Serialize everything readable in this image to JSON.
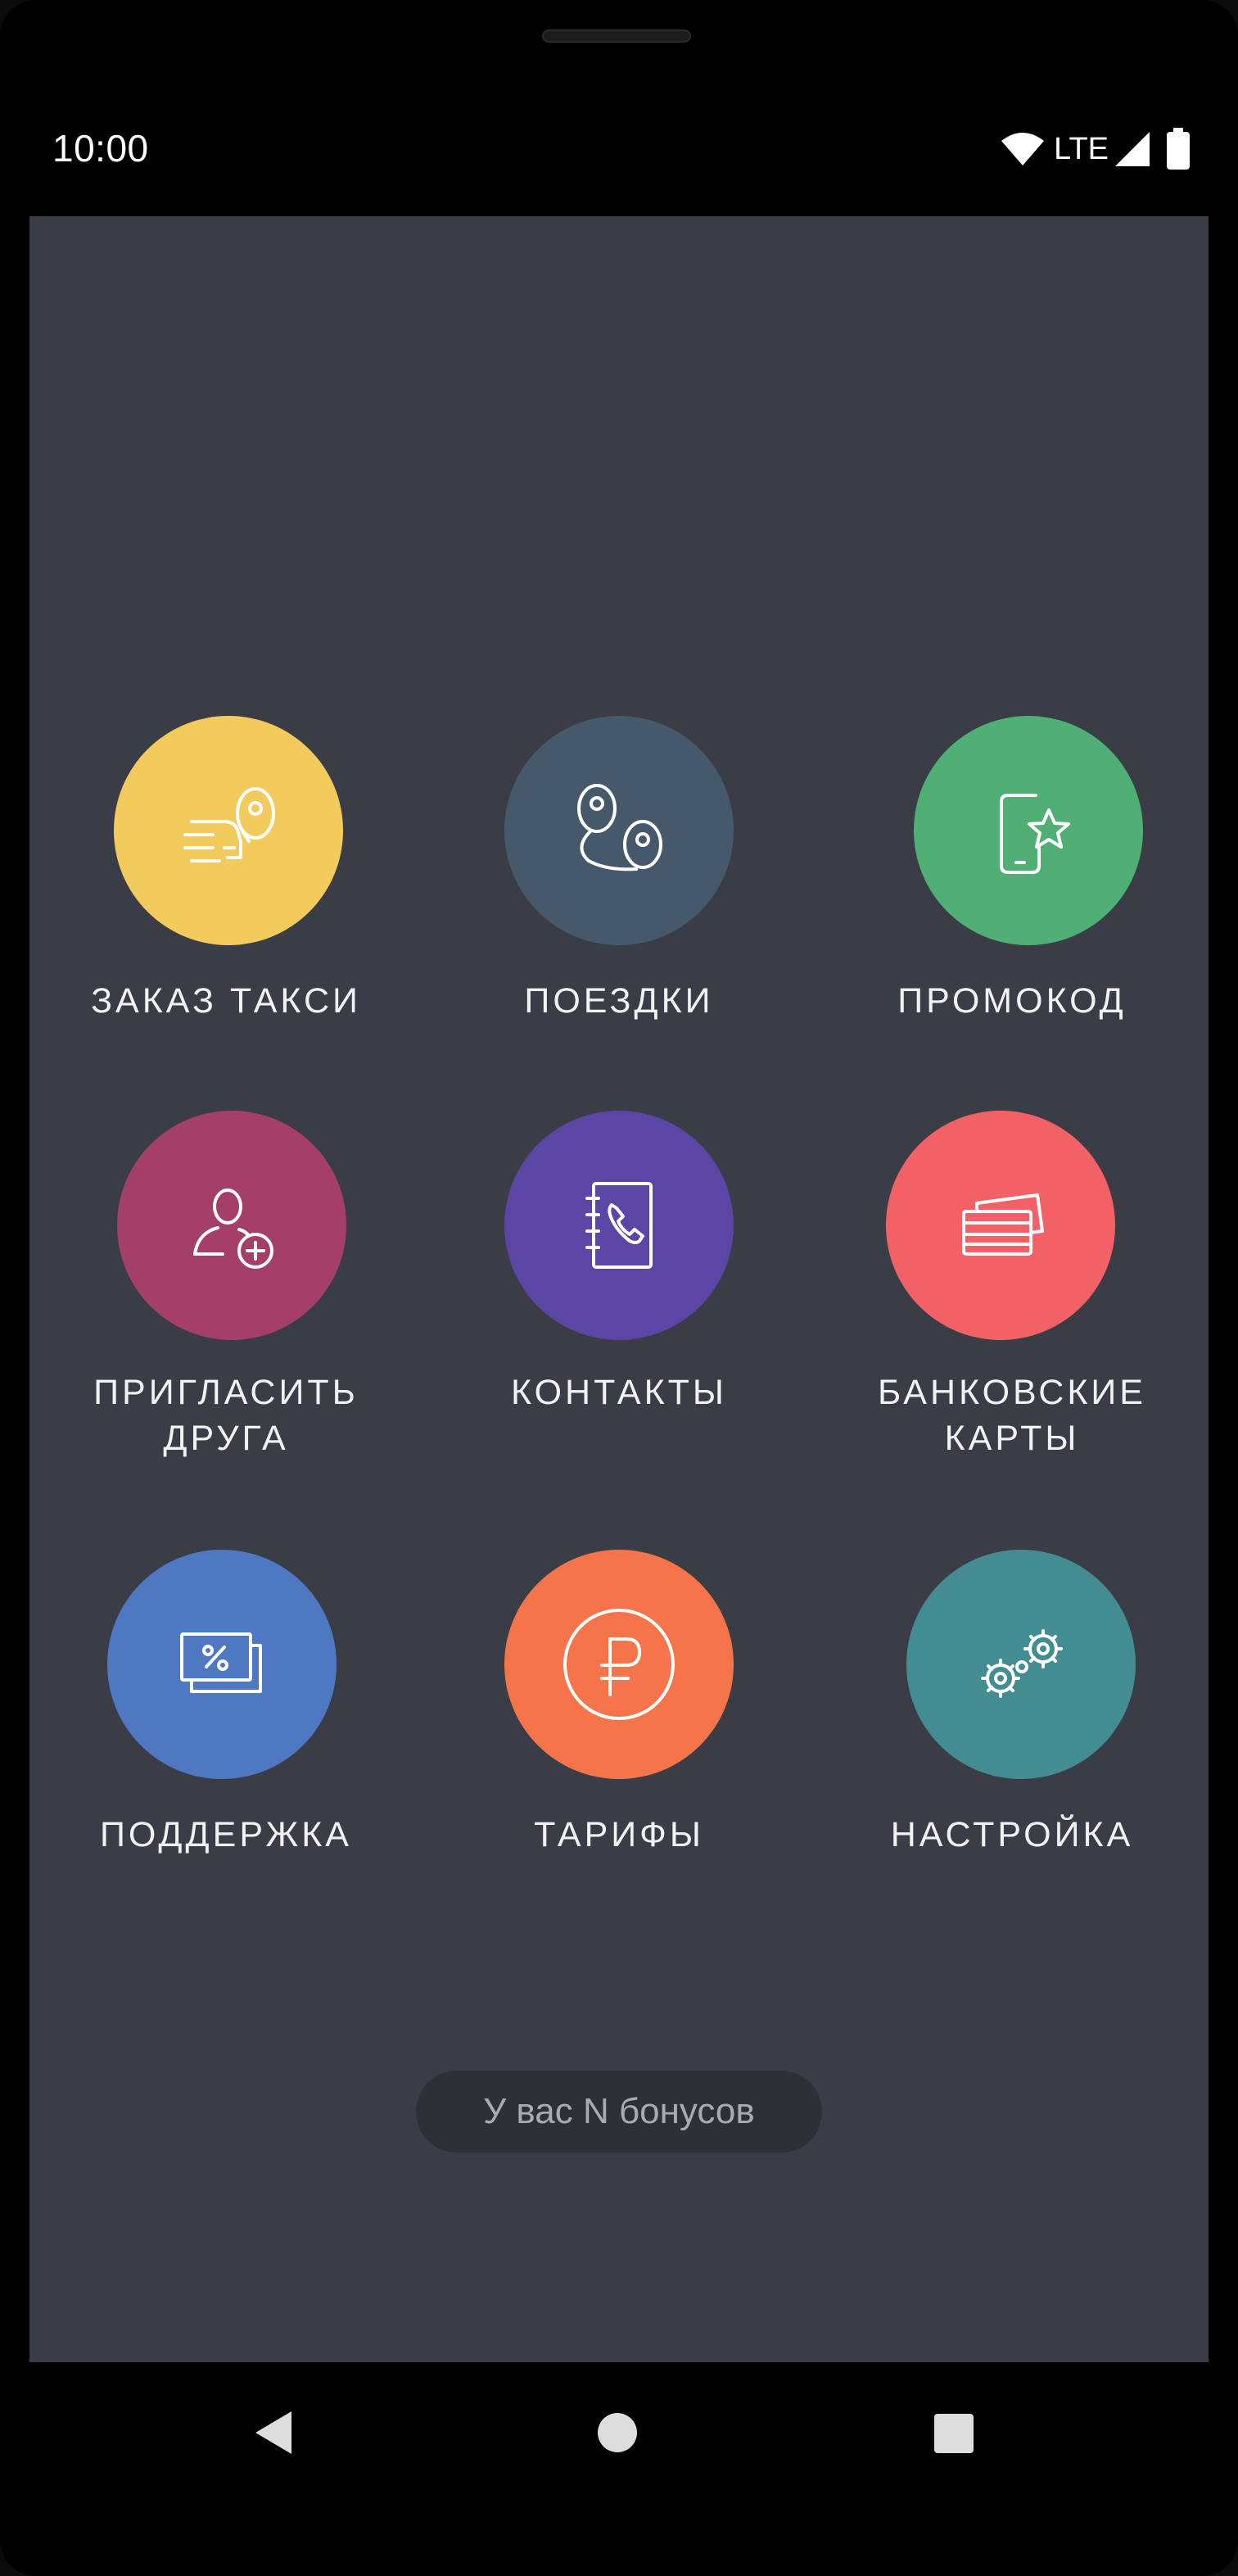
{
  "status_bar": {
    "time": "10:00",
    "network": "LTE",
    "icons": [
      "wifi-icon",
      "signal-icon",
      "battery-icon"
    ]
  },
  "menu": {
    "tiles": [
      {
        "label": "ЗАКАЗ ТАКСИ",
        "color": "#f2cb5c",
        "icon": "taxi-order-icon"
      },
      {
        "label": "ПОЕЗДКИ",
        "color": "#46596b",
        "icon": "trips-route-icon"
      },
      {
        "label": "ПРОМОКОД",
        "color": "#4faf75",
        "icon": "promo-phone-star-icon"
      },
      {
        "label": "ПРИГЛАСИТЬ\nДРУГА",
        "color": "#a33f68",
        "icon": "invite-friend-icon"
      },
      {
        "label": "КОНТАКТЫ",
        "color": "#5b45a5",
        "icon": "contacts-book-phone-icon"
      },
      {
        "label": "БАНКОВСКИЕ\nКАРТЫ",
        "color": "#f26165",
        "icon": "bank-cards-icon"
      },
      {
        "label": "ПОДДЕРЖКА",
        "color": "#4f78c2",
        "icon": "support-percent-coupon-icon"
      },
      {
        "label": "ТАРИФЫ",
        "color": "#f57449",
        "icon": "ruble-tariffs-icon"
      },
      {
        "label": "НАСТРОЙКА",
        "color": "#438c92",
        "icon": "settings-gears-icon"
      }
    ]
  },
  "bonus_pill": "У вас N бонусов",
  "nav_bar": {
    "buttons": [
      "back-icon",
      "home-icon",
      "recents-icon"
    ]
  },
  "colors": {
    "screen_bg": "#3a3d45",
    "bezel": "#000000"
  }
}
